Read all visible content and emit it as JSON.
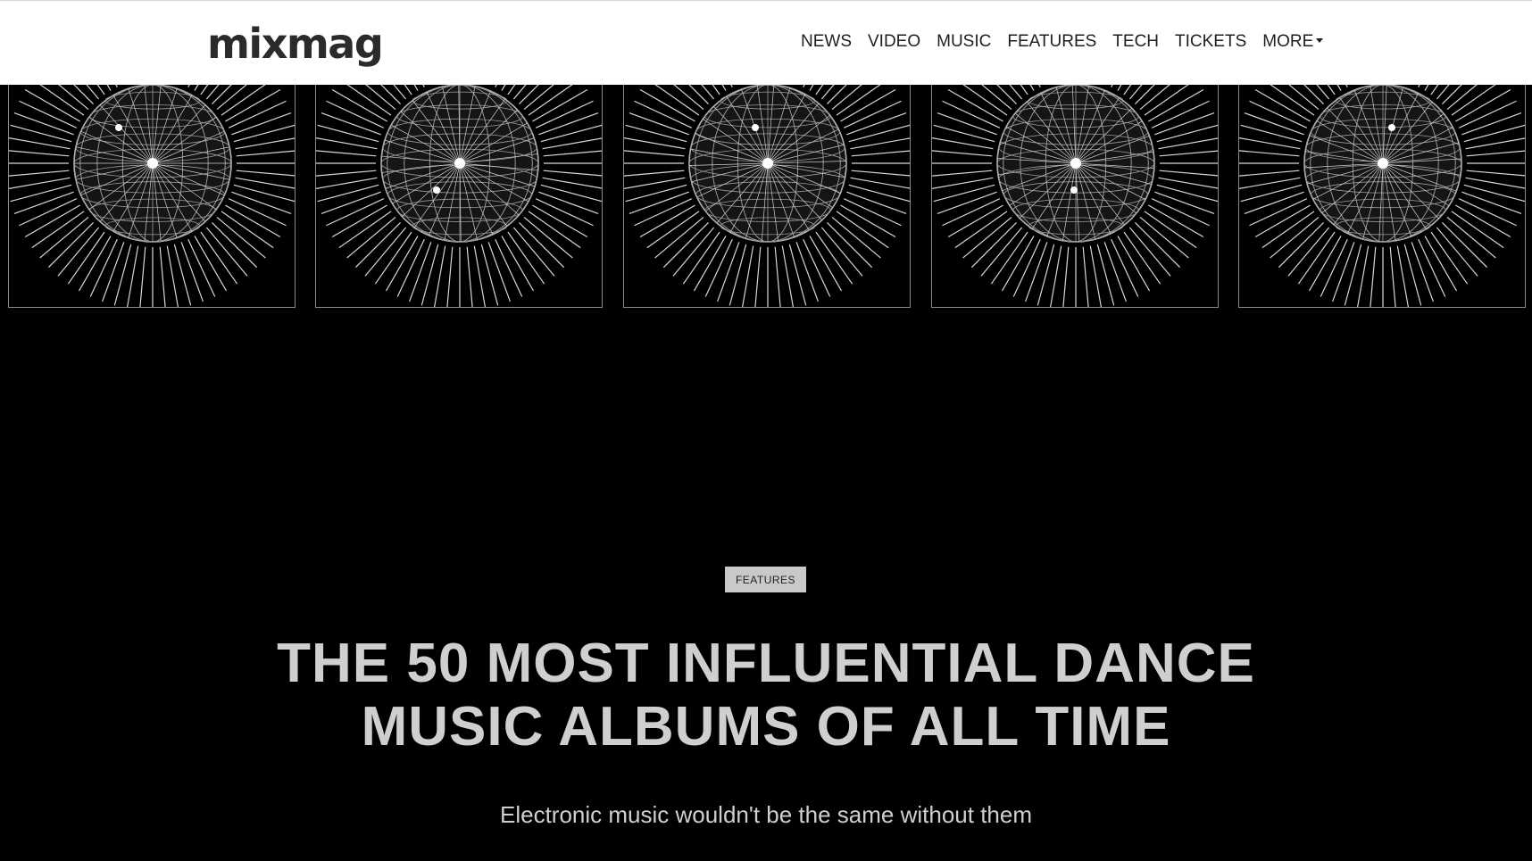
{
  "header": {
    "logo": "mixmag",
    "nav": [
      {
        "label": "NEWS"
      },
      {
        "label": "VIDEO"
      },
      {
        "label": "MUSIC"
      },
      {
        "label": "FEATURES"
      },
      {
        "label": "TECH"
      },
      {
        "label": "TICKETS"
      },
      {
        "label": "MORE",
        "dropdown": true
      }
    ]
  },
  "hero": {
    "image_description_icon": "disco-ball-icon",
    "tiles": 5
  },
  "article": {
    "category": "FEATURES",
    "title_line1": "THE 50 MOST INFLUENTIAL DANCE",
    "title_line2": "MUSIC ALBUMS OF ALL TIME",
    "subtitle": "Electronic music wouldn't be the same without them"
  },
  "colors": {
    "background": "#000000",
    "header_bg": "#ffffff",
    "title_text": "#cfcfcf",
    "badge_bg": "#c9c9c9"
  }
}
